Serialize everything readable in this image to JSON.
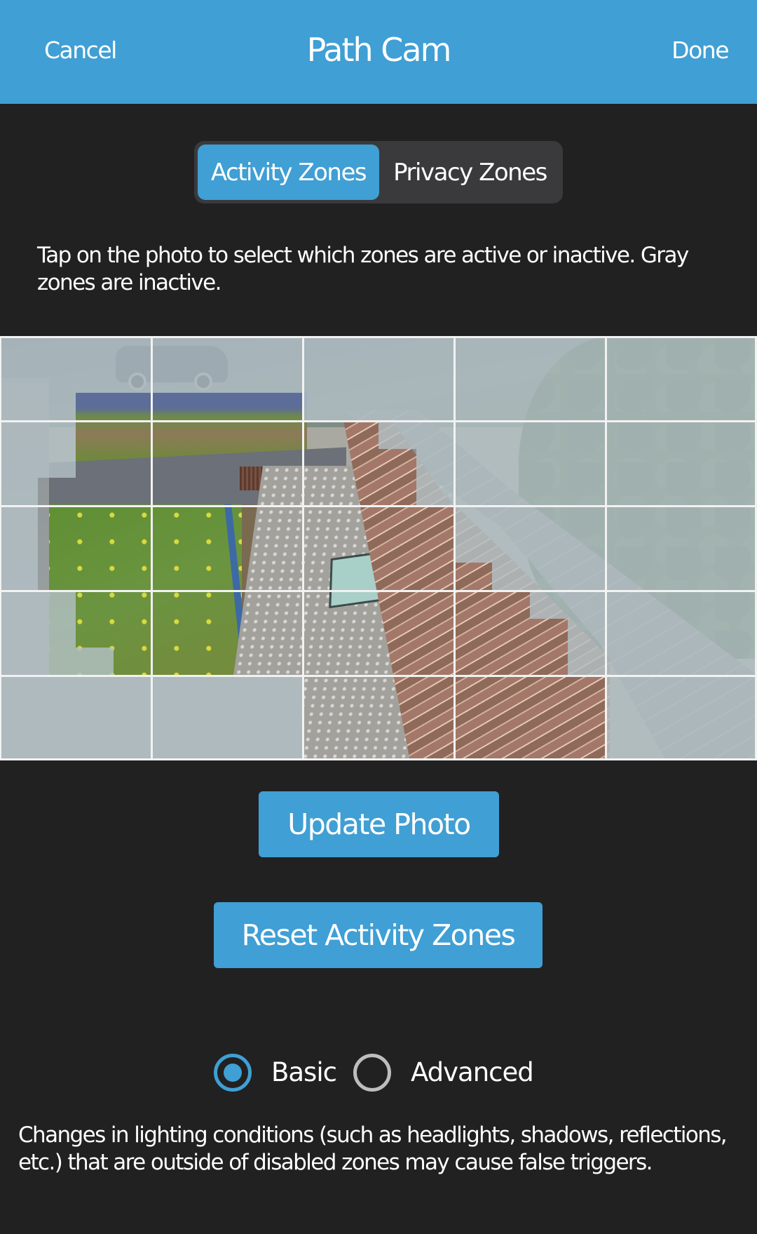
{
  "header": {
    "cancel_label": "Cancel",
    "title": "Path Cam",
    "done_label": "Done"
  },
  "tabs": [
    {
      "label": "Activity Zones",
      "selected": true
    },
    {
      "label": "Privacy Zones",
      "selected": false
    }
  ],
  "instructions": "Tap on the photo to select which zones are active or inactive. Gray zones are inactive.",
  "zone_grid": {
    "major_columns": 5,
    "major_rows": 5,
    "sub_columns": 20,
    "sub_rows": 15,
    "active_mask": [
      "00000000000000000000",
      "00000000000000000000",
      "00111111000000000000",
      "00111111110000000000",
      "00111111111000000000",
      "01111111111000000000",
      "01111111111100000000",
      "01111111111100000000",
      "01111111111110000000",
      "00111111111111000000",
      "00111111111111100000",
      "00011111111111100000",
      "00000000111111110000",
      "00000000111111110000",
      "00000000111111110000"
    ]
  },
  "buttons": {
    "update_photo": "Update Photo",
    "reset_zones": "Reset Activity Zones"
  },
  "sensitivity_mode": {
    "options": [
      {
        "label": "Basic",
        "selected": true
      },
      {
        "label": "Advanced",
        "selected": false
      }
    ]
  },
  "footnote": "Changes in lighting conditions (such as headlights, shadows, reflections, etc.) that are outside of disabled zones may cause false triggers.",
  "colors": {
    "accent": "#409fd4",
    "background": "#212121",
    "segmented_bg": "#3a3a3c",
    "inactive_zone_overlay": "#b2c0c4",
    "radio_unselected": "#bdbdbd"
  }
}
